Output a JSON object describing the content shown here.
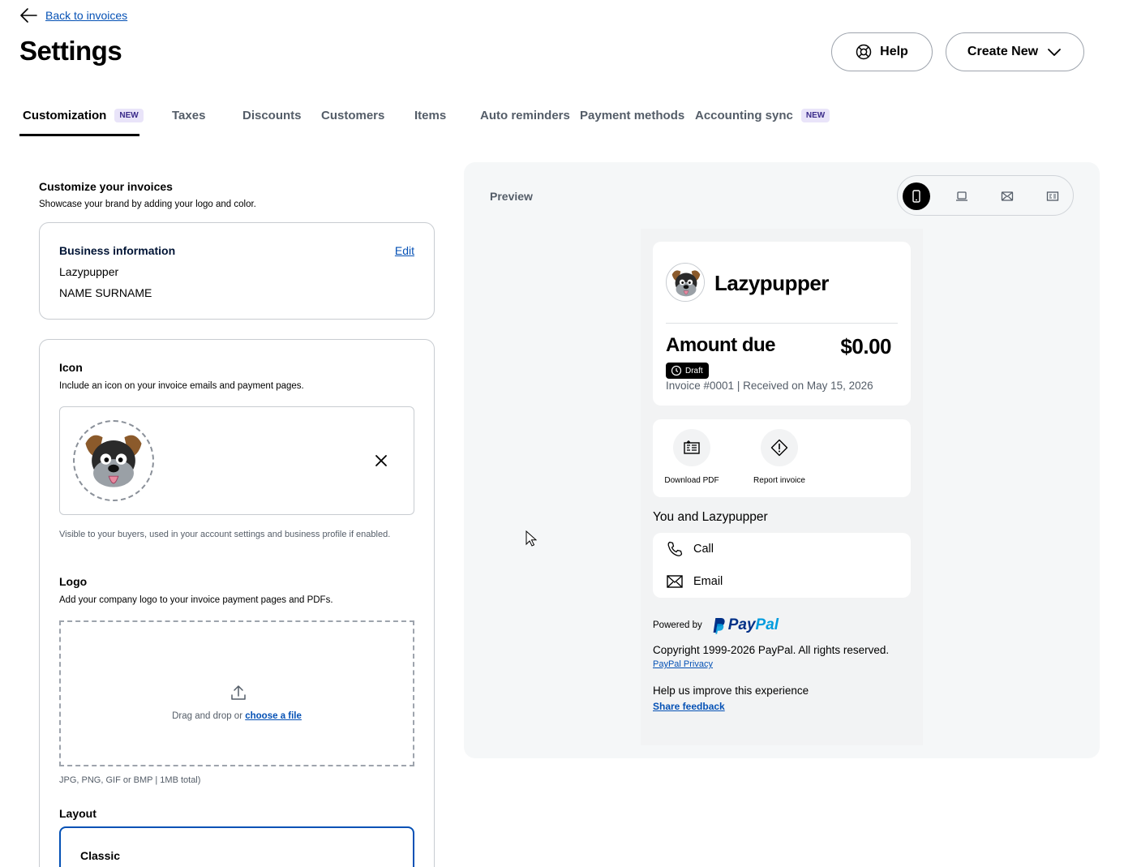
{
  "nav": {
    "back_label": "Back to invoices"
  },
  "page": {
    "title": "Settings"
  },
  "header": {
    "help_label": "Help",
    "create_label": "Create New"
  },
  "tabs": [
    {
      "label": "Customization",
      "badge": "NEW"
    },
    {
      "label": "Taxes"
    },
    {
      "label": "Discounts"
    },
    {
      "label": "Customers"
    },
    {
      "label": "Items"
    },
    {
      "label": "Auto reminders"
    },
    {
      "label": "Payment methods"
    },
    {
      "label": "Accounting sync",
      "badge": "NEW"
    }
  ],
  "customize": {
    "title": "Customize your invoices",
    "subtitle": "Showcase your brand by adding your logo and color."
  },
  "business": {
    "title": "Business information",
    "edit_label": "Edit",
    "name": "Lazypupper",
    "owner": "NAME SURNAME"
  },
  "icon_section": {
    "title": "Icon",
    "subtitle": "Include an icon on your invoice emails and payment pages.",
    "helper": "Visible to your buyers, used in your account settings and business profile if enabled."
  },
  "logo_section": {
    "title": "Logo",
    "subtitle": "Add your company logo to your invoice payment pages and PDFs.",
    "drop_text": "Drag and drop or ",
    "choose_link": "choose a file",
    "file_hint": "JPG, PNG, GIF or BMP | 1MB total)"
  },
  "layout_section": {
    "title": "Layout",
    "selected": "Classic"
  },
  "preview": {
    "label": "Preview",
    "business_name": "Lazypupper",
    "amount_label": "Amount due",
    "amount_value": "$0.00",
    "status": "Draft",
    "invoice_meta": "Invoice #0001 | Received on May 15, 2026",
    "download_label": "Download PDF",
    "report_label": "Report invoice",
    "you_and": "You and Lazypupper",
    "call_label": "Call",
    "email_label": "Email",
    "powered_by": "Powered by",
    "pp_word_a": "Pay",
    "pp_word_b": "Pal",
    "copyright": "Copyright 1999-2026 PayPal. All rights reserved.",
    "privacy_link": "PayPal Privacy",
    "help_improve": "Help us improve this experience",
    "feedback_link": "Share feedback"
  },
  "colors": {
    "link": "#0551b5",
    "paypal_dark": "#003087",
    "paypal_light": "#009cde",
    "badge_bg": "#e9e4f9"
  }
}
